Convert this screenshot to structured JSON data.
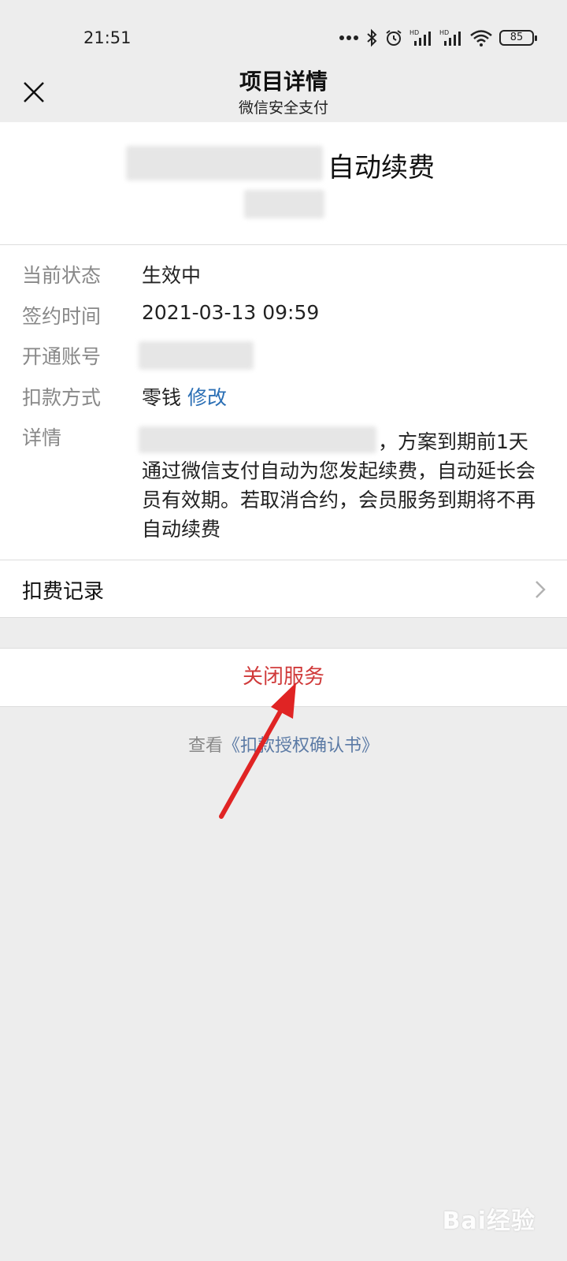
{
  "status_bar": {
    "time": "21:51",
    "battery": "85",
    "icons": [
      "more-dots-icon",
      "bluetooth-icon",
      "alarm-icon",
      "hd-signal-icon",
      "hd-signal-icon",
      "wifi-icon",
      "battery-icon"
    ]
  },
  "nav": {
    "title": "项目详情",
    "subtitle": "微信安全支付",
    "close_icon": "close-icon"
  },
  "header": {
    "title_suffix": "自动续费"
  },
  "details": {
    "status_label": "当前状态",
    "status_value": "生效中",
    "signed_label": "签约时间",
    "signed_value": "2021-03-13 09:59",
    "account_label": "开通账号",
    "payment_label": "扣款方式",
    "payment_value": "零钱",
    "payment_modify": "修改",
    "detail_label": "详情",
    "detail_first": "，方案到期前1天",
    "detail_rest": "通过微信支付自动为您发起续费，自动延长会员有效期。若取消合约，会员服务到期将不再自动续费"
  },
  "records": {
    "label": "扣费记录",
    "chevron_icon": "chevron-right-icon"
  },
  "actions": {
    "close_service": "关闭服务"
  },
  "footer": {
    "prefix": "查看",
    "doc_link": "《扣款授权确认书》"
  },
  "watermark": {
    "text": "Bai经验"
  },
  "colors": {
    "background": "#ededed",
    "danger": "#d03a3a",
    "link": "#2b6fb5",
    "annotation_arrow": "#e02424"
  }
}
